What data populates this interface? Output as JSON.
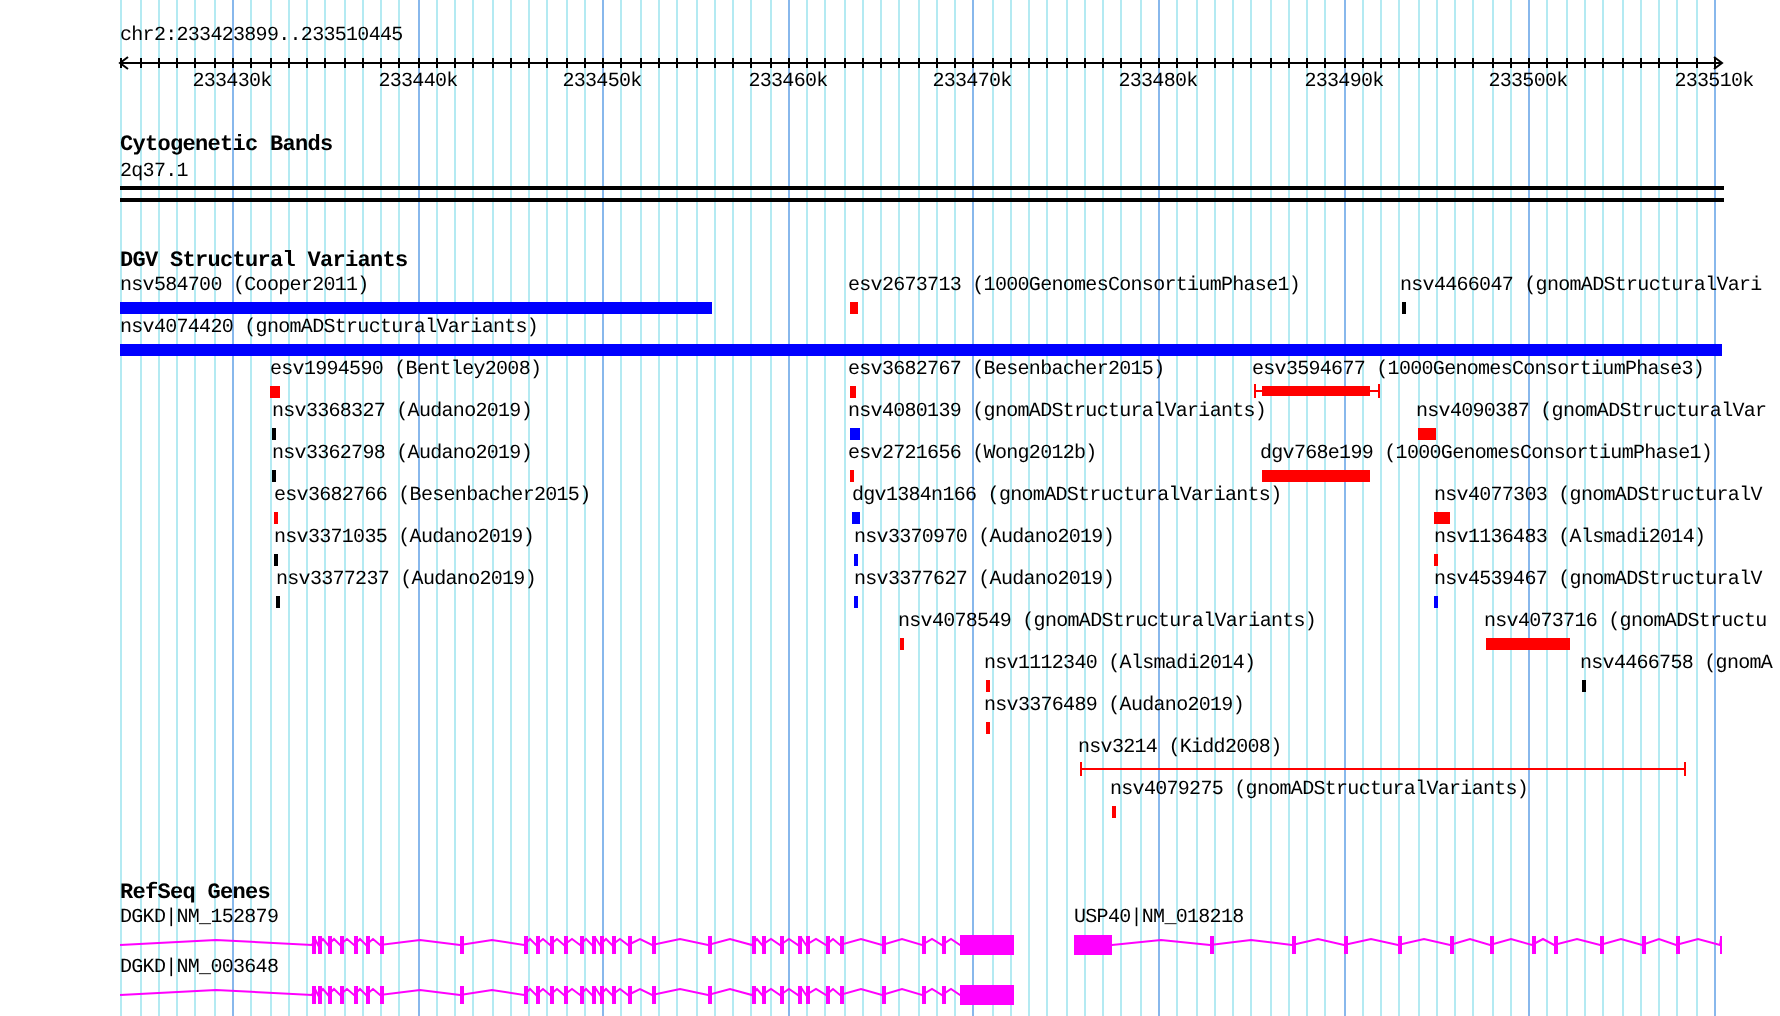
{
  "ruler": {
    "location": "chr2:233423899..233510445",
    "ticks": [
      "233430k",
      "233440k",
      "233450k",
      "233460k",
      "233470k",
      "233480k",
      "233490k",
      "233500k",
      "233510k"
    ]
  },
  "cytogenetic_bands": {
    "title": "Cytogenetic Bands",
    "bands": [
      {
        "label": "2q37.1"
      }
    ]
  },
  "dgv_structural_variants": {
    "title": "DGV Structural Variants",
    "rows": [
      [
        {
          "label": "nsv584700 (Cooper2011)",
          "color": "#0000ff",
          "kind": "bar"
        },
        {
          "label": "esv2673713 (1000GenomesConsortiumPhase1)",
          "color": "#ff0000",
          "kind": "bar"
        },
        {
          "label": "nsv4466047 (gnomADStructuralVari",
          "color": "#000000",
          "kind": "bar"
        }
      ],
      [
        {
          "label": "nsv4074420 (gnomADStructuralVariants)",
          "color": "#0000ff",
          "kind": "bar"
        }
      ],
      [
        {
          "label": "esv1994590 (Bentley2008)",
          "color": "#ff0000",
          "kind": "bar"
        },
        {
          "label": "esv3682767 (Besenbacher2015)",
          "color": "#ff0000",
          "kind": "bar"
        },
        {
          "label": "esv3594677 (1000GenomesConsortiumPhase3)",
          "color": "#ff0000",
          "kind": "capped"
        }
      ],
      [
        {
          "label": "nsv3368327 (Audano2019)",
          "color": "#000000",
          "kind": "bar"
        },
        {
          "label": "nsv4080139 (gnomADStructuralVariants)",
          "color": "#0000ff",
          "kind": "bar"
        },
        {
          "label": "nsv4090387 (gnomADStructuralVar",
          "color": "#ff0000",
          "kind": "bar"
        }
      ],
      [
        {
          "label": "nsv3362798 (Audano2019)",
          "color": "#000000",
          "kind": "bar"
        },
        {
          "label": "esv2721656 (Wong2012b)",
          "color": "#ff0000",
          "kind": "bar"
        },
        {
          "label": "dgv768e199 (1000GenomesConsortiumPhase1)",
          "color": "#ff0000",
          "kind": "bar"
        }
      ],
      [
        {
          "label": "esv3682766 (Besenbacher2015)",
          "color": "#ff0000",
          "kind": "bar"
        },
        {
          "label": "dgv1384n166 (gnomADStructuralVariants)",
          "color": "#0000ff",
          "kind": "bar"
        },
        {
          "label": "nsv4077303 (gnomADStructuralV",
          "color": "#ff0000",
          "kind": "bar"
        }
      ],
      [
        {
          "label": "nsv3371035 (Audano2019)",
          "color": "#000000",
          "kind": "bar"
        },
        {
          "label": "nsv3370970 (Audano2019)",
          "color": "#0000ff",
          "kind": "bar"
        },
        {
          "label": "nsv1136483 (Alsmadi2014)",
          "color": "#ff0000",
          "kind": "bar"
        }
      ],
      [
        {
          "label": "nsv3377237 (Audano2019)",
          "color": "#000000",
          "kind": "bar"
        },
        {
          "label": "nsv3377627 (Audano2019)",
          "color": "#0000ff",
          "kind": "bar"
        },
        {
          "label": "nsv4539467 (gnomADStructuralV",
          "color": "#0000ff",
          "kind": "bar"
        }
      ],
      [
        {
          "label": "nsv4078549 (gnomADStructuralVariants)",
          "color": "#ff0000",
          "kind": "bar"
        },
        {
          "label": "nsv4073716 (gnomADStructu",
          "color": "#ff0000",
          "kind": "bar"
        }
      ],
      [
        {
          "label": "nsv1112340 (Alsmadi2014)",
          "color": "#ff0000",
          "kind": "bar"
        },
        {
          "label": "nsv4466758 (gnomA",
          "color": "#000000",
          "kind": "bar"
        }
      ],
      [
        {
          "label": "nsv3376489 (Audano2019)",
          "color": "#ff0000",
          "kind": "bar"
        }
      ],
      [
        {
          "label": "nsv3214 (Kidd2008)",
          "color": "#ff0000",
          "kind": "capped"
        }
      ],
      [
        {
          "label": "nsv4079275 (gnomADStructuralVariants)",
          "color": "#ff0000",
          "kind": "bar"
        }
      ]
    ]
  },
  "refseq_genes": {
    "title": "RefSeq Genes",
    "rows": [
      [
        {
          "label": "DGKD|NM_152879"
        },
        {
          "label": "USP40|NM_018218"
        }
      ],
      [
        {
          "label": "DGKD|NM_003648"
        }
      ]
    ]
  }
}
